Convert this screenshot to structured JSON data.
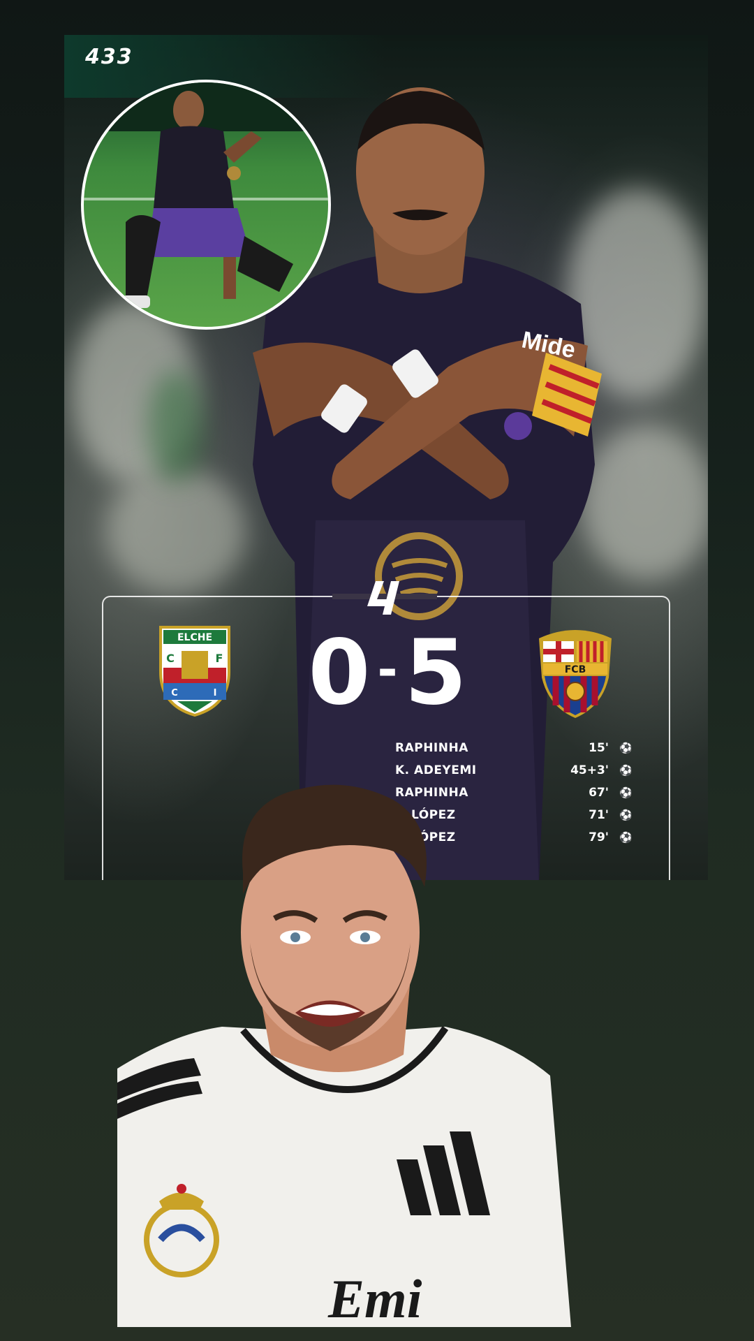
{
  "brand": "433",
  "match": {
    "home_team": "ELCHE",
    "home_crest_letters": [
      "C",
      "F",
      "C",
      "I"
    ],
    "away_crest_letters": "FCB",
    "home_score": "0",
    "separator": "-",
    "away_score": "5"
  },
  "scorers": [
    {
      "name": "RAPHINHA",
      "minute": "15'",
      "icon": "soccer-ball-icon"
    },
    {
      "name": "K. ADEYEMI",
      "minute": "45+3'",
      "icon": "soccer-ball-icon"
    },
    {
      "name": "RAPHINHA",
      "minute": "67'",
      "icon": "soccer-ball-icon"
    },
    {
      "name": "F. LÓPEZ",
      "minute": "71'",
      "icon": "soccer-ball-icon"
    },
    {
      "name": "F. LÓPEZ",
      "minute": "79'",
      "icon": "soccer-ball-icon"
    }
  ],
  "shirt_text": {
    "player_sponsor": "Mide",
    "reactor_sponsor": "Emi"
  },
  "colors": {
    "accent_green": "#0e3a2c",
    "barca_blue": "#1a3f8f",
    "barca_red": "#a8102e",
    "elche_green": "#1d7a3c"
  }
}
